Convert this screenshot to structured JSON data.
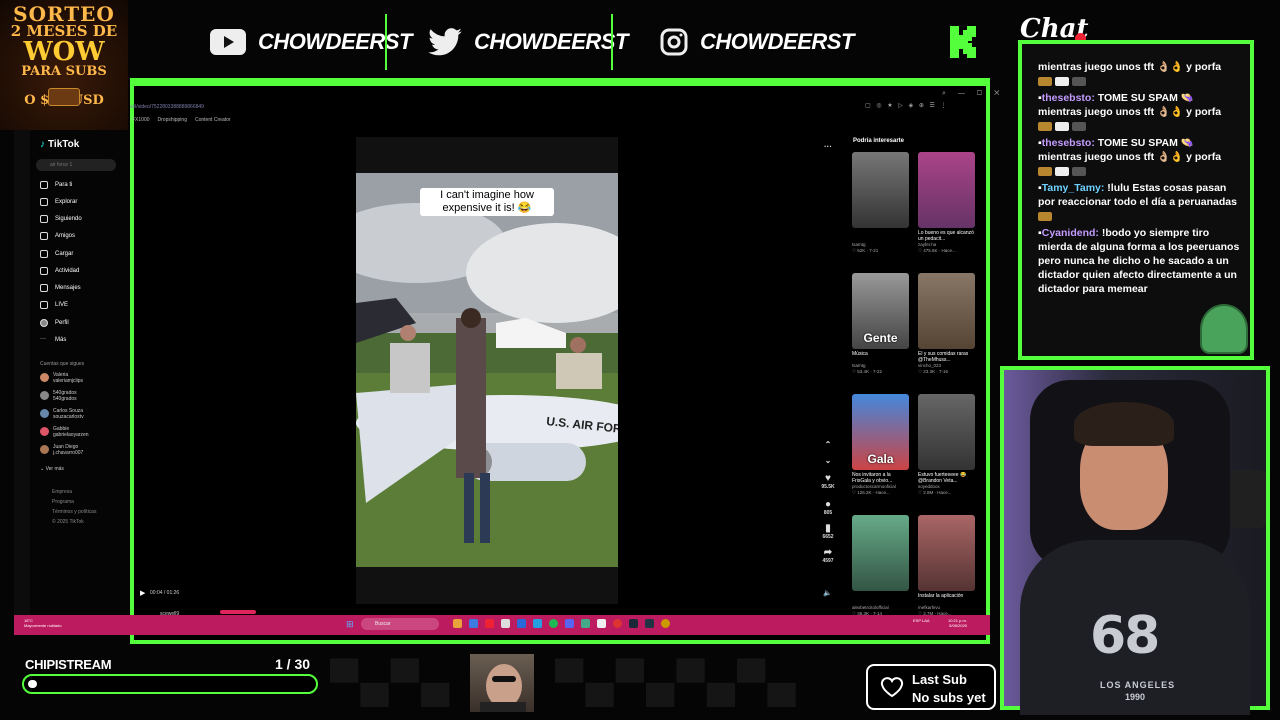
{
  "promo": {
    "line1": "SORTEO",
    "line2": "2 MESES DE",
    "line3": "WOW",
    "line4": "PARA SUBS",
    "line5": "O $30 USD"
  },
  "socials": [
    {
      "platform": "youtube-icon",
      "handle": "CHOWDEERST"
    },
    {
      "platform": "twitter-icon",
      "handle": "CHOWDEERST"
    },
    {
      "platform": "instagram-icon",
      "handle": "CHOWDEERST"
    }
  ],
  "browser": {
    "url": "al/i/video/7522803388889866849",
    "bookmarks": [
      "FX1000",
      "Dropshipping",
      "Content Creator"
    ]
  },
  "tiktok": {
    "logo": "TikTok",
    "search_placeholder": "air force 1",
    "nav": [
      "Para ti",
      "Explorar",
      "Siguiendo",
      "Amigos",
      "Cargar",
      "Actividad",
      "Mensajes",
      "LIVE",
      "Perfil",
      "Más"
    ],
    "following_header": "Cuentas que sigues",
    "following": [
      {
        "name": "Valeria",
        "handle": "valeriamjclips",
        "color": "#c86"
      },
      {
        "name": "540grados",
        "handle": "540grados",
        "color": "#888"
      },
      {
        "name": "Carlos Souza",
        "handle": "souzacarlostv",
        "color": "#68a"
      },
      {
        "name": "Gabbie",
        "handle": "gabrielaoyarzen",
        "color": "#d56"
      },
      {
        "name": "Juan Diego",
        "handle": "j.chavarro007",
        "color": "#a75"
      }
    ],
    "see_more": "Ver más",
    "footer": [
      "Empresa",
      "Programa",
      "Términos y políticas",
      "© 2025 TikTok"
    ],
    "video_caption": "I can't imagine how expensive it is! 😂",
    "plane_text": "U.S. AIR FORCE",
    "actions": [
      {
        "icon": "heart-icon",
        "value": "95.5K"
      },
      {
        "icon": "comment-icon",
        "value": "805"
      },
      {
        "icon": "bookmark-icon",
        "value": "6652"
      },
      {
        "icon": "share-icon",
        "value": "4597"
      }
    ],
    "time": "00:04 / 01:26",
    "author": "scewell9",
    "rec_header": "Podría interesarte",
    "recs": [
      {
        "caption": "",
        "channel": "tsamtg",
        "stats": "♡ 52K · 7-21",
        "bg": "linear-gradient(#777,#333)"
      },
      {
        "caption": "Lo bueno es que alcanzó un pedacit...",
        "channel": "zayfer.ha",
        "stats": "♡ 475.6K · Hace...",
        "bg": "linear-gradient(#a48,#636)"
      },
      {
        "caption": "Música",
        "channel": "tsamtg",
        "stats": "♡ 53.4K · 7-22",
        "bg": "linear-gradient(#999,#444)",
        "overlay": "Gente"
      },
      {
        "caption": "El y sus comidas raras @TheMhuss...",
        "channel": "vincho_023",
        "stats": "♡ 23.3K · 7-16",
        "bg": "linear-gradient(#876,#543)"
      },
      {
        "caption": "Nos invitaron a la FrisGala y obvio...",
        "channel": "productoscarmooficial",
        "stats": "♡ 126.2K · Hace...",
        "bg": "linear-gradient(#48d,#c44)",
        "overlay": "Gala"
      },
      {
        "caption": "Estuvo fuerteeeee 😂 @Brandon Veta...",
        "channel": "soyeddoox",
        "stats": "♡ 2.8M · Hace...",
        "bg": "linear-gradient(#666,#333)"
      },
      {
        "caption": "",
        "channel": "alexbetrcitolofficial",
        "stats": "♡ 36.3K · 7-14",
        "bg": "linear-gradient(#6a8,#354)"
      },
      {
        "caption": "Instalar la aplicación",
        "channel": "mefkarhivu",
        "stats": "♡ 2,7M · Hace...",
        "bg": "linear-gradient(#a66,#533)"
      }
    ]
  },
  "taskbar": {
    "weather_temp": "18°C",
    "weather_desc": "Mayormente nublado",
    "search": "Buscar",
    "lang": "ESP LAA",
    "time": "10:21 p.m.",
    "date": "5/08/2025"
  },
  "chat": {
    "title": "Chat",
    "messages": [
      {
        "user": "",
        "text": "mientras juego unos tft 👌🏼👌 y porfa"
      },
      {
        "user": "thesebsto:",
        "text": "TOME SU SPAM 👒 mientras juego unos tft 👌🏼👌 y porfa"
      },
      {
        "user": "thesebsto:",
        "text": "TOME SU SPAM 👒 mientras juego unos tft 👌🏼👌 y porfa"
      },
      {
        "user": "Tamy_Tamy:",
        "text": "!lulu Estas cosas pasan por reaccionar todo el día a peruanadas"
      },
      {
        "user": "Cyanidend:",
        "text": "!bodo yo siempre tiro mierda de alguna forma a los peeruanos pero nunca he dicho o he sacado a un dictador quien afecto directamente a un dictador para memear"
      }
    ]
  },
  "webcam": {
    "shirt_number": "68",
    "shirt_text": "LOS ANGELES",
    "shirt_year": "1990"
  },
  "goal": {
    "label": "CHIPISTREAM",
    "count": "1 / 30",
    "progress": 0.033
  },
  "last_sub": {
    "title": "Last Sub",
    "value": "No subs yet"
  },
  "colors": {
    "accent": "#54ff3c",
    "bar": "#bd1b60",
    "chat_user": "#c39bff"
  }
}
